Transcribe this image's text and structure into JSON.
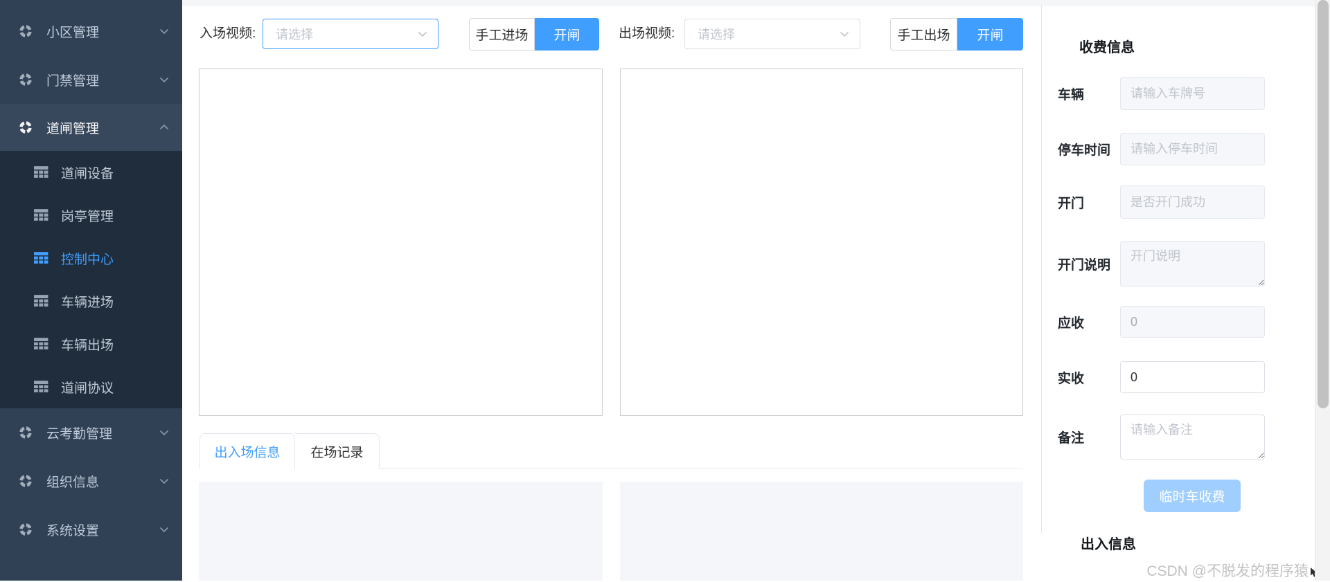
{
  "sidebar": {
    "items": [
      {
        "label": "小区管理",
        "arrow": "down",
        "expanded": false
      },
      {
        "label": "门禁管理",
        "arrow": "down",
        "expanded": false
      },
      {
        "label": "道闸管理",
        "arrow": "up",
        "expanded": true
      },
      {
        "label": "云考勤管理",
        "arrow": "down",
        "expanded": false
      },
      {
        "label": "组织信息",
        "arrow": "down",
        "expanded": false
      },
      {
        "label": "系统设置",
        "arrow": "down",
        "expanded": false
      }
    ],
    "submenu": [
      {
        "label": "道闸设备",
        "active": false
      },
      {
        "label": "岗亭管理",
        "active": false
      },
      {
        "label": "控制中心",
        "active": true
      },
      {
        "label": "车辆进场",
        "active": false
      },
      {
        "label": "车辆出场",
        "active": false
      },
      {
        "label": "道闸协议",
        "active": false
      }
    ]
  },
  "toolbar": {
    "entry_label": "入场视频:",
    "entry_select_placeholder": "请选择",
    "entry_manual_button": "手工进场",
    "entry_open_button": "开闸",
    "exit_label": "出场视频:",
    "exit_select_placeholder": "请选择",
    "exit_manual_button": "手工出场",
    "exit_open_button": "开闸"
  },
  "tabs": [
    {
      "label": "出入场信息",
      "active": true
    },
    {
      "label": "在场记录",
      "active": false
    }
  ],
  "fee_panel": {
    "title": "收费信息",
    "fields": [
      {
        "label": "车辆",
        "placeholder": "请输入车牌号",
        "disabled": true
      },
      {
        "label": "停车时间",
        "placeholder": "请输入停车时间",
        "disabled": true
      },
      {
        "label": "开门",
        "placeholder": "是否开门成功",
        "disabled": true
      },
      {
        "label": "开门说明",
        "placeholder": "开门说明",
        "disabled": true
      },
      {
        "label": "应收",
        "value": "0",
        "disabled": true
      },
      {
        "label": "实收",
        "value": "0",
        "disabled": false
      },
      {
        "label": "备注",
        "placeholder": "请输入备注",
        "disabled": false
      }
    ],
    "submit_button": "临时车收费"
  },
  "access_panel": {
    "title": "出入信息"
  },
  "watermark": "CSDN @不脱发的程序猿",
  "colors": {
    "accent": "#409EFF",
    "sidebar_bg": "#304156",
    "submenu_bg": "#1f2d3d",
    "sidebar_text": "#bfcbd9",
    "disabled_button": "#a0cfff"
  }
}
